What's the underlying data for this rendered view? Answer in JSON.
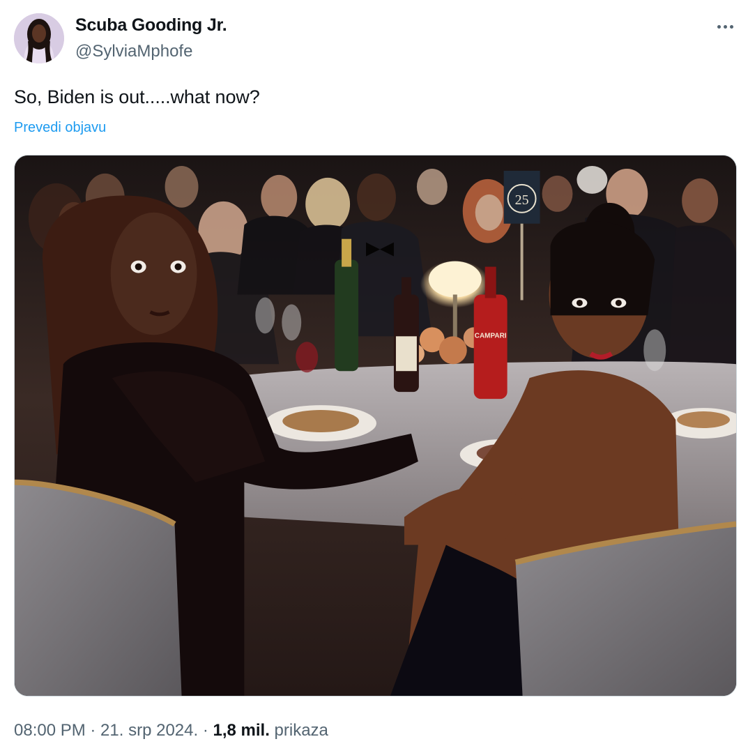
{
  "author": {
    "display_name": "Scuba Gooding Jr.",
    "handle": "@SylviaMphofe"
  },
  "tweet": {
    "text": "So, Biden is out.....what now?",
    "translate_label": "Prevedi objavu",
    "timestamp": "08:00 PM · 21. srp 2024.",
    "separator": " · ",
    "views_count": "1,8 mil.",
    "views_label": " prikaza"
  },
  "photo": {
    "table_number": "25",
    "bottle_label": "CAMPARI"
  },
  "icons": {
    "more": "more-horizontal-icon",
    "avatar": "profile-avatar"
  },
  "colors": {
    "text_primary": "#0f1419",
    "text_secondary": "#536471",
    "link": "#1d9bf0"
  }
}
